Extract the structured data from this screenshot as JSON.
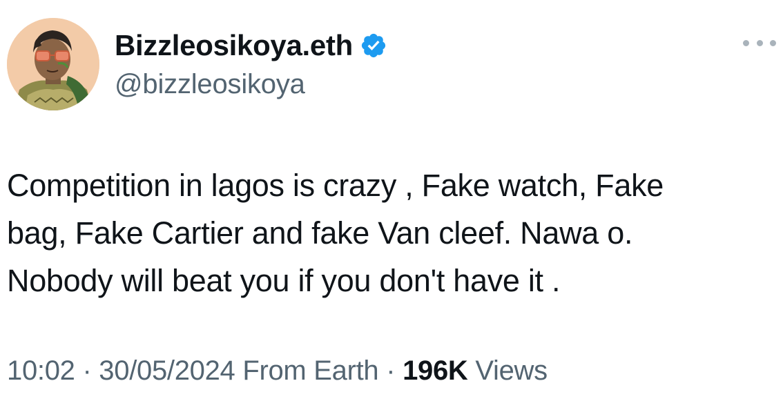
{
  "author": {
    "display_name": "Bizzleosikoya.eth",
    "handle": "@bizzleosikoya",
    "verified": true,
    "verified_color": "#1d9bf0"
  },
  "tweet": {
    "lines": [
      "Competition in lagos is crazy , Fake watch, Fake",
      "bag, Fake Cartier and fake Van cleef. Nawa o.",
      "Nobody will beat you if you don't have it ."
    ]
  },
  "meta": {
    "time": "10:02",
    "separator": "·",
    "date": "30/05/2024",
    "source": "From Earth",
    "views_count": "196K",
    "views_label": "Views"
  },
  "icons": {
    "more": "more-options-icon",
    "verified": "verified-badge-icon"
  },
  "colors": {
    "text_primary": "#0f1419",
    "text_secondary": "#536471",
    "background": "#ffffff"
  }
}
